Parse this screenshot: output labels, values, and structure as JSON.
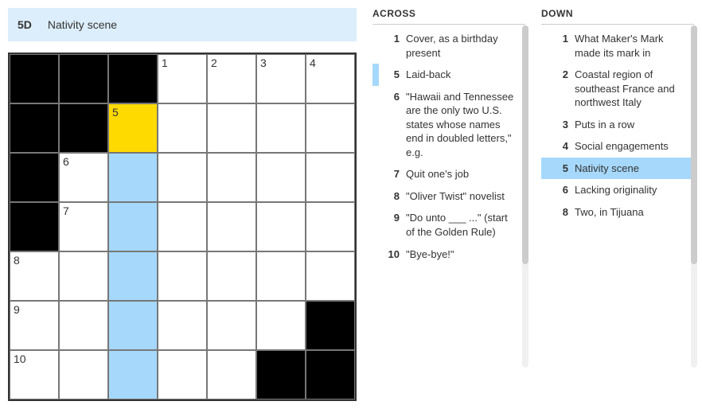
{
  "current_clue": {
    "label": "5D",
    "text": "Nativity scene"
  },
  "grid": {
    "rows": 7,
    "cols": 7,
    "cells": [
      [
        {
          "black": true
        },
        {
          "black": true
        },
        {
          "black": true
        },
        {
          "num": "1"
        },
        {
          "num": "2"
        },
        {
          "num": "3"
        },
        {
          "num": "4"
        }
      ],
      [
        {
          "black": true
        },
        {
          "black": true
        },
        {
          "num": "5",
          "focus": true
        },
        {},
        {},
        {},
        {}
      ],
      [
        {
          "black": true
        },
        {
          "num": "6"
        },
        {
          "hl": true
        },
        {},
        {},
        {},
        {}
      ],
      [
        {
          "black": true
        },
        {
          "num": "7"
        },
        {
          "hl": true
        },
        {},
        {},
        {},
        {}
      ],
      [
        {
          "num": "8"
        },
        {},
        {
          "hl": true
        },
        {},
        {},
        {},
        {}
      ],
      [
        {
          "num": "9"
        },
        {},
        {
          "hl": true
        },
        {},
        {},
        {},
        {
          "black": true
        }
      ],
      [
        {
          "num": "10"
        },
        {},
        {
          "hl": true
        },
        {},
        {},
        {
          "black": true
        },
        {
          "black": true
        }
      ]
    ]
  },
  "across": {
    "header": "ACROSS",
    "clues": [
      {
        "num": "1",
        "text": "Cover, as a birthday present"
      },
      {
        "num": "5",
        "text": "Laid-back",
        "related": true
      },
      {
        "num": "6",
        "text": "\"Hawaii and Tennessee are the only two U.S. states whose names end in doubled letters,\" e.g."
      },
      {
        "num": "7",
        "text": "Quit one's job"
      },
      {
        "num": "8",
        "text": "\"Oliver Twist\" novelist"
      },
      {
        "num": "9",
        "text": "\"Do unto ___ ...\" (start of the Golden Rule)"
      },
      {
        "num": "10",
        "text": "\"Bye-bye!\""
      }
    ]
  },
  "down": {
    "header": "DOWN",
    "clues": [
      {
        "num": "1",
        "text": "What Maker's Mark made its mark in"
      },
      {
        "num": "2",
        "text": "Coastal region of southeast France and northwest Italy"
      },
      {
        "num": "3",
        "text": "Puts in a row"
      },
      {
        "num": "4",
        "text": "Social engagements"
      },
      {
        "num": "5",
        "text": "Nativity scene",
        "active": true
      },
      {
        "num": "6",
        "text": "Lacking originality"
      },
      {
        "num": "8",
        "text": "Two, in Tijuana"
      }
    ]
  }
}
